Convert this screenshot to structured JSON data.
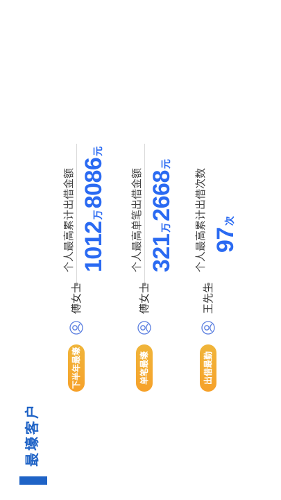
{
  "page": {
    "title": "最壕客户",
    "accent_color": "#1f63c6",
    "value_color": "#2a6af2",
    "badge_color": "#f6a12a"
  },
  "records": [
    {
      "badge": "下半年最壕",
      "avatar_icon": "user-avatar-icon",
      "name": "傅女士",
      "label": "个人最高累计出借金额",
      "value_main": "1012",
      "value_unit_1": "万",
      "value_tail": "8086",
      "value_unit_2": "元"
    },
    {
      "badge": "单笔最壕",
      "avatar_icon": "user-avatar-icon",
      "name": "傅女士",
      "label": "个人最高单笔出借金额",
      "value_main": "321",
      "value_unit_1": "万",
      "value_tail": "2668",
      "value_unit_2": "元"
    },
    {
      "badge": "出借最勤",
      "avatar_icon": "user-avatar-icon",
      "name": "王先生",
      "label": "个人最高累计出借次数",
      "value_main": "97",
      "value_unit_1": "次",
      "value_tail": "",
      "value_unit_2": ""
    }
  ]
}
